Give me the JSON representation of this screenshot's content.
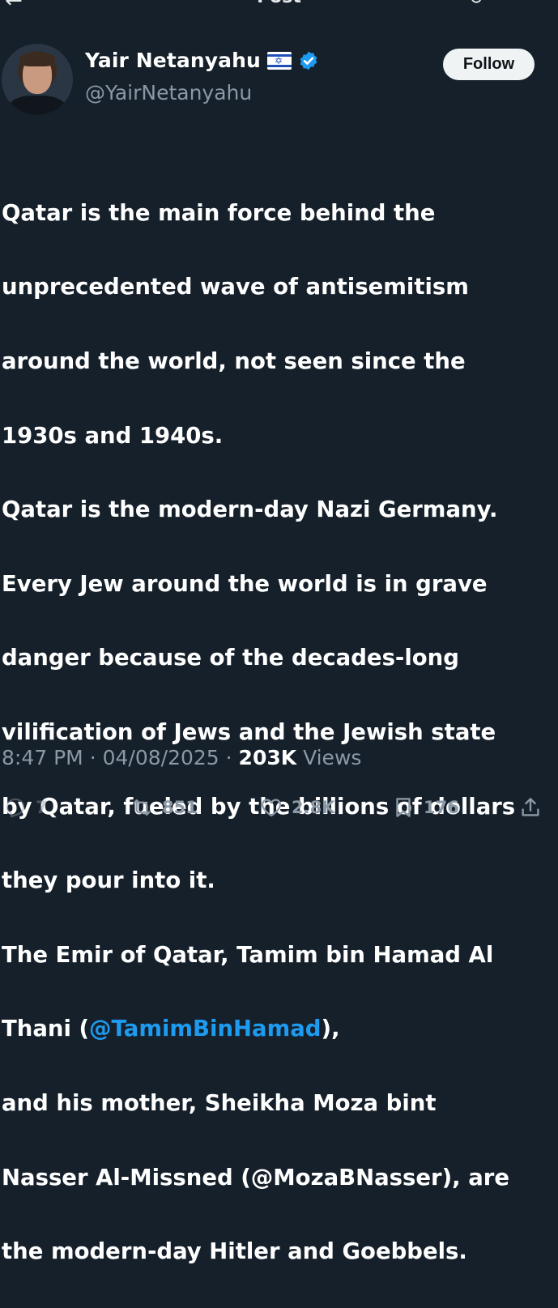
{
  "topbar": {
    "title": "Post"
  },
  "author": {
    "name": "Yair Netanyahu",
    "handle": "@YairNetanyahu"
  },
  "follow_label": "Follow",
  "post": {
    "lines": [
      "Qatar is the main force behind the",
      "unprecedented wave of antisemitism",
      "around the world, not seen since the",
      "1930s and 1940s.",
      "Qatar is the modern-day Nazi Germany.",
      "Every Jew around the world is in grave",
      "danger because of the decades-long",
      "vilification of Jews and the Jewish state",
      "by Qatar, fueled by the billions of dollars",
      "they pour into it.",
      "The Emir of Qatar, Tamim bin Hamad Al"
    ],
    "line12_pre": "Thani (",
    "mention": "@TamimBinHamad",
    "line12_post": "),",
    "lines_after": [
      "and his mother, Sheikha Moza bint",
      "Nasser Al-Missned (@MozaBNasser), are",
      "the modern-day Hitler and Goebbels."
    ]
  },
  "meta": {
    "time": "8:47 PM",
    "date": "04/08/2025",
    "views_count": "203K",
    "views_label": "Views",
    "separator": "·"
  },
  "actions": {
    "replies": "7",
    "reposts": "851",
    "likes": "2.8K",
    "bookmarks": "176"
  },
  "colors": {
    "background": "#15202b",
    "accent": "#1d9bf0",
    "muted": "#8b98a5"
  }
}
